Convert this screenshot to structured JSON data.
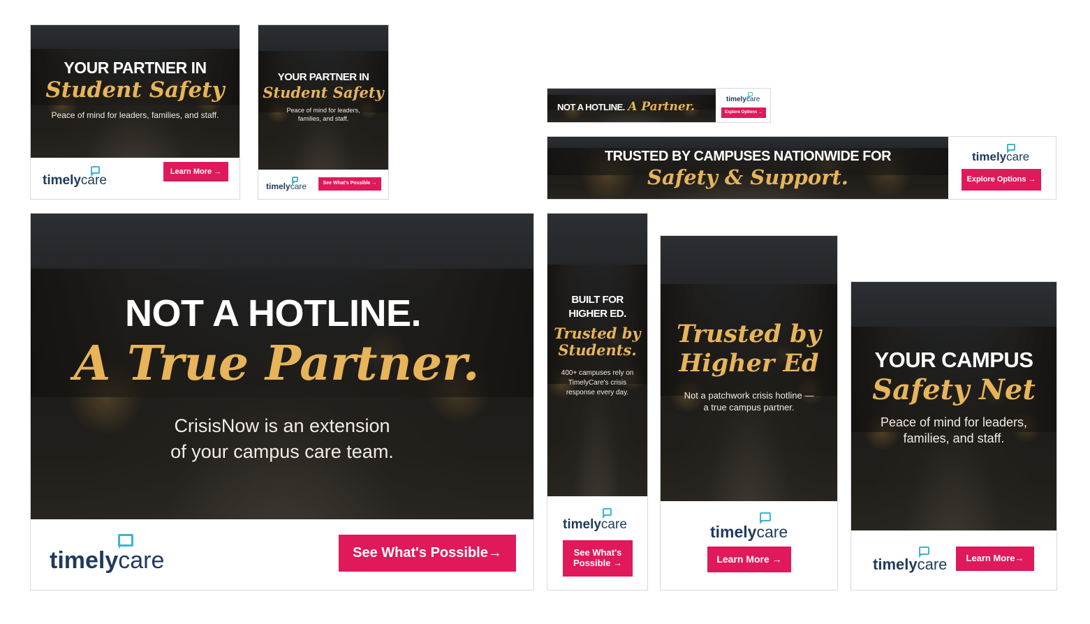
{
  "brand": {
    "logo_regular": "timely",
    "logo_accent": "care",
    "cta_color": "#e0195a",
    "gold_color": "#e7b45a",
    "navy_color": "#1e3a5c",
    "teal_color": "#3fb4cf"
  },
  "ad1": {
    "headline_white": "YOUR PARTNER IN",
    "headline_gold": "Student Safety",
    "subtext": "Peace of mind for leaders, families, and staff.",
    "cta": "Learn More →"
  },
  "ad2": {
    "headline_white": "YOUR PARTNER IN",
    "headline_gold": "Student Safety",
    "subtext": "Peace of mind for leaders, families, and staff.",
    "cta": "See What's Possible →"
  },
  "ad3": {
    "headline_white": "NOT A HOTLINE.",
    "headline_gold": "A Partner.",
    "cta": "Explore Options →"
  },
  "ad4": {
    "headline_white": "TRUSTED BY CAMPUSES NATIONWIDE FOR",
    "headline_gold": "Safety & Support.",
    "cta": "Explore Options →"
  },
  "ad5": {
    "headline_white": "NOT A HOTLINE.",
    "headline_gold": "A True Partner.",
    "subtext_line1": "CrisisNow is an extension",
    "subtext_line2": "of your campus care team.",
    "cta": "See What's Possible→"
  },
  "ad6": {
    "headline_white_1": "BUILT FOR",
    "headline_white_2": "HIGHER ED.",
    "headline_gold_1": "Trusted by",
    "headline_gold_2": "Students.",
    "subtext": "400+ campuses rely on TimelyCare's crisis response every day.",
    "cta": "See What's Possible →"
  },
  "ad7": {
    "headline_gold_1": "Trusted by",
    "headline_gold_2": "Higher Ed",
    "subtext_line1": "Not a patchwork crisis hotline —",
    "subtext_line2": "a true campus partner.",
    "cta": "Learn More →"
  },
  "ad8": {
    "headline_white": "YOUR CAMPUS",
    "headline_gold": "Safety Net",
    "subtext_line1": "Peace of mind for leaders,",
    "subtext_line2": "families, and staff.",
    "cta": "Learn More→"
  }
}
